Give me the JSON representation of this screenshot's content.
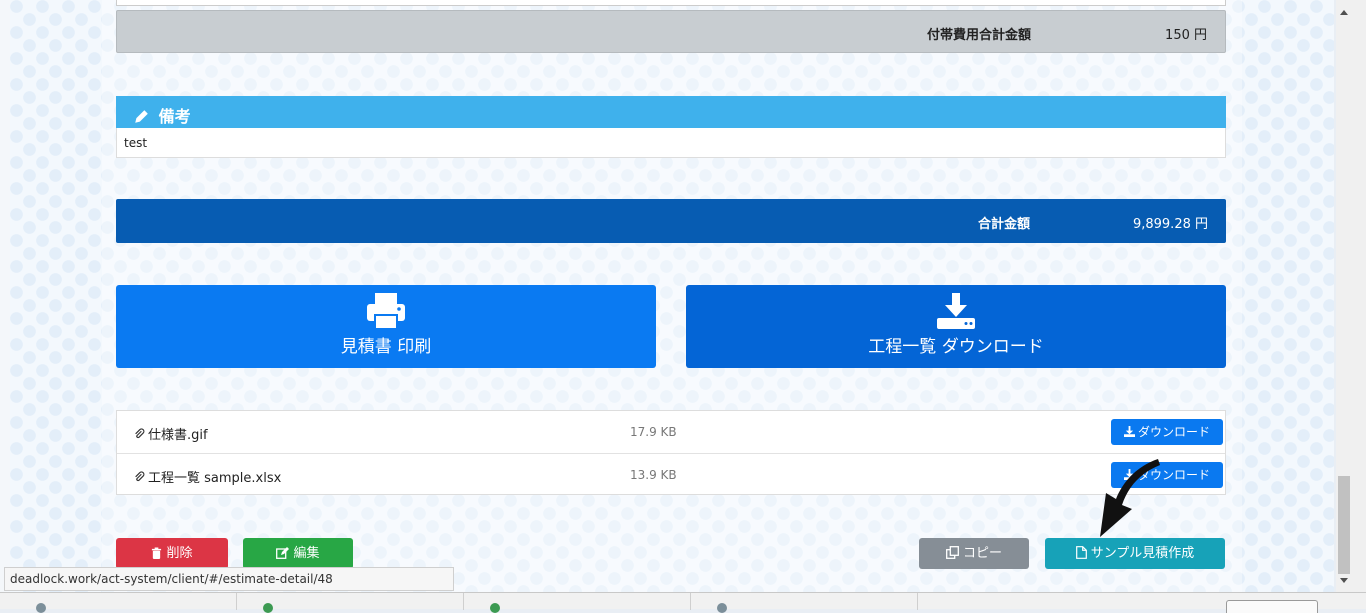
{
  "fees": {
    "label": "付帯費用合計金額",
    "amount": "150 円"
  },
  "note": {
    "title": "備考",
    "body": "test"
  },
  "total": {
    "label": "合計金額",
    "amount": "9,899.28 円"
  },
  "actions": {
    "print_label": "見積書 印刷",
    "process_download_label": "工程一覧 ダウンロード"
  },
  "files": [
    {
      "name": "仕様書.gif",
      "size": "17.9 KB",
      "download_label": "ダウンロード"
    },
    {
      "name": "工程一覧 sample.xlsx",
      "size": "13.9 KB",
      "download_label": "ダウンロード"
    }
  ],
  "buttons": {
    "delete": "削除",
    "edit": "編集",
    "copy": "コピー",
    "sample": "サンプル見積作成"
  },
  "status_url": "deadlock.work/act-system/client/#/estimate-detail/48",
  "colors": {
    "primary": "#0a7af2",
    "header": "#3fb1ec",
    "total": "#075cb2",
    "danger": "#dc3545",
    "success": "#28a745",
    "secondary": "#868e96",
    "info": "#17a2b8"
  }
}
